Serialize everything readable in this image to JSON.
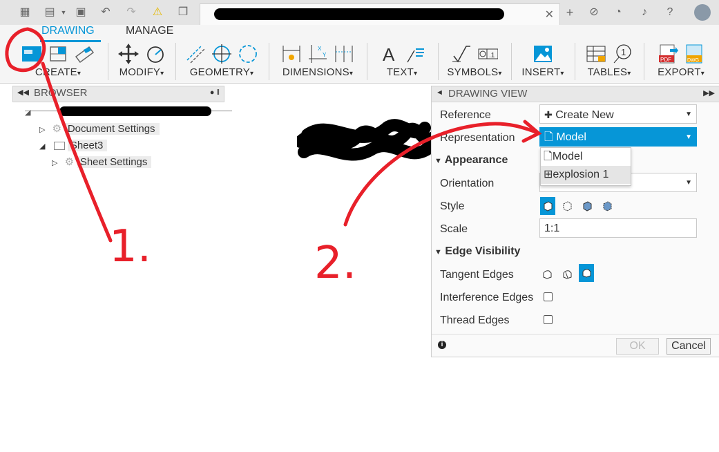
{
  "ribbon": {
    "tabs": [
      "DRAWING",
      "MANAGE"
    ],
    "groups": [
      "CREATE",
      "MODIFY",
      "GEOMETRY",
      "DIMENSIONS",
      "TEXT",
      "SYMBOLS",
      "INSERT",
      "TABLES",
      "EXPORT"
    ],
    "dropdown_marker": "▾"
  },
  "browser": {
    "title": "BROWSER",
    "items": [
      "Document Settings",
      "Sheet3",
      "Sheet Settings"
    ]
  },
  "panel": {
    "title": "DRAWING VIEW",
    "reference_label": "Reference",
    "reference_value": "Create New",
    "representation_label": "Representation",
    "representation_value": "Model",
    "representation_options": [
      "Model",
      "explosion 1"
    ],
    "appearance_label": "Appearance",
    "orientation_label": "Orientation",
    "style_label": "Style",
    "scale_label": "Scale",
    "scale_value": "1:1",
    "edge_visibility_label": "Edge Visibility",
    "tangent_label": "Tangent Edges",
    "interference_label": "Interference Edges",
    "thread_label": "Thread Edges",
    "ok_label": "OK",
    "cancel_label": "Cancel"
  },
  "annotations": [
    "1.",
    "2."
  ],
  "colors": {
    "accent": "#0696d7",
    "annotation": "#e8202a"
  }
}
